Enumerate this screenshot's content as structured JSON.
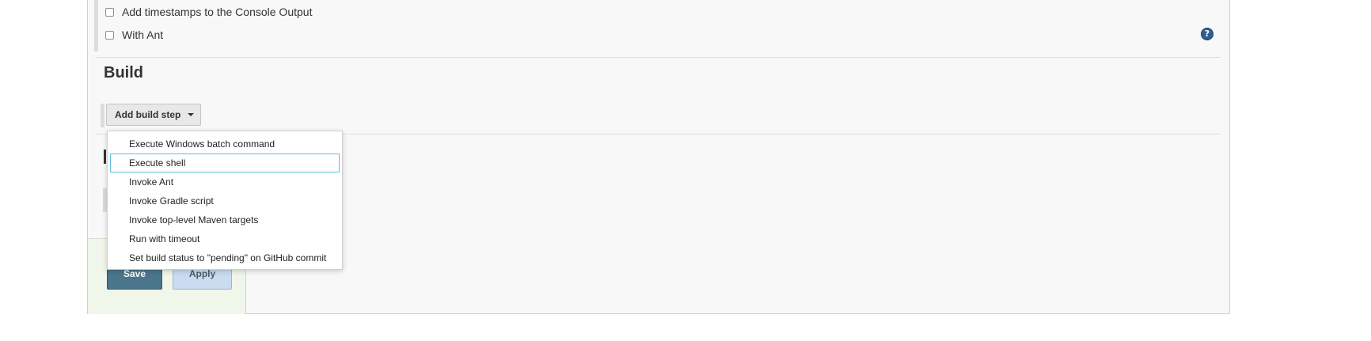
{
  "options": {
    "items": [
      {
        "label": "Add timestamps to the Console Output",
        "checked": false
      },
      {
        "label": "With Ant",
        "checked": false
      }
    ],
    "help_icon_glyph": "?"
  },
  "build": {
    "title": "Build",
    "add_step_label": "Add build step",
    "menu": {
      "items": [
        {
          "label": "Execute Windows batch command"
        },
        {
          "label": "Execute shell"
        },
        {
          "label": "Invoke Ant"
        },
        {
          "label": "Invoke Gradle script"
        },
        {
          "label": "Invoke top-level Maven targets"
        },
        {
          "label": "Run with timeout"
        },
        {
          "label": "Set build status to \"pending\" on GitHub commit"
        }
      ],
      "focused_item": "Execute shell"
    }
  },
  "footer": {
    "save_label": "Save",
    "apply_label": "Apply"
  },
  "colors": {
    "save_button": "#4b758b",
    "apply_button": "#c9dcf0",
    "focus_outline": "#5bc0de",
    "help_icon": "#2f5f8f"
  },
  "icons": {
    "help": "help-icon",
    "dropdown": "chevron-down-icon"
  }
}
